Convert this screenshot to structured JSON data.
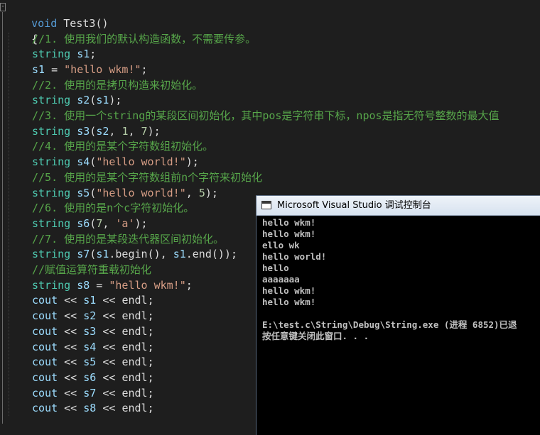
{
  "editor": {
    "fold_glyph": "-",
    "header": [
      "void",
      " ",
      "Test3",
      "()"
    ],
    "brace_open": "{",
    "brace_close": "}",
    "lines": [
      {
        "ind": 1,
        "tokens": [
          [
            "cmt",
            "//1. 使用我们的默认构造函数，不需要传参。"
          ]
        ]
      },
      {
        "ind": 1,
        "tokens": [
          [
            "ty",
            "string"
          ],
          [
            "op",
            " "
          ],
          [
            "var",
            "s1"
          ],
          [
            "op",
            ";"
          ]
        ]
      },
      {
        "ind": 1,
        "tokens": [
          [
            "var",
            "s1"
          ],
          [
            "op",
            " = "
          ],
          [
            "str",
            "\"hello wkm!\""
          ],
          [
            "op",
            ";"
          ]
        ]
      },
      {
        "ind": 1,
        "tokens": [
          [
            "cmt",
            "//2. 使用的是拷贝构造来初始化。"
          ]
        ]
      },
      {
        "ind": 1,
        "tokens": [
          [
            "ty",
            "string"
          ],
          [
            "op",
            " "
          ],
          [
            "var",
            "s2"
          ],
          [
            "op",
            "("
          ],
          [
            "var",
            "s1"
          ],
          [
            "op",
            ");"
          ]
        ]
      },
      {
        "ind": 1,
        "tokens": [
          [
            "cmt",
            "//3. 使用一个string的某段区间初始化，其中pos是字符串下标，npos是指无符号整数的最大值"
          ]
        ]
      },
      {
        "ind": 1,
        "tokens": [
          [
            "ty",
            "string"
          ],
          [
            "op",
            " "
          ],
          [
            "var",
            "s3"
          ],
          [
            "op",
            "("
          ],
          [
            "var",
            "s2"
          ],
          [
            "op",
            ", "
          ],
          [
            "num",
            "1"
          ],
          [
            "op",
            ", "
          ],
          [
            "num",
            "7"
          ],
          [
            "op",
            ");"
          ]
        ]
      },
      {
        "ind": 1,
        "tokens": [
          [
            "cmt",
            "//4. 使用的是某个字符数组初始化。"
          ]
        ]
      },
      {
        "ind": 1,
        "tokens": [
          [
            "ty",
            "string"
          ],
          [
            "op",
            " "
          ],
          [
            "var",
            "s4"
          ],
          [
            "op",
            "("
          ],
          [
            "str",
            "\"hello world!\""
          ],
          [
            "op",
            ");"
          ]
        ]
      },
      {
        "ind": 1,
        "tokens": [
          [
            "cmt",
            "//5. 使用的是某个字符数组前n个字符来初始化"
          ]
        ]
      },
      {
        "ind": 1,
        "tokens": [
          [
            "ty",
            "string"
          ],
          [
            "op",
            " "
          ],
          [
            "var",
            "s5"
          ],
          [
            "op",
            "("
          ],
          [
            "str",
            "\"hello world!\""
          ],
          [
            "op",
            ", "
          ],
          [
            "num",
            "5"
          ],
          [
            "op",
            ");"
          ]
        ]
      },
      {
        "ind": 1,
        "tokens": [
          [
            "cmt",
            "//6. 使用的是n个c字符初始化。"
          ]
        ]
      },
      {
        "ind": 1,
        "tokens": [
          [
            "ty",
            "string"
          ],
          [
            "op",
            " "
          ],
          [
            "var",
            "s6"
          ],
          [
            "op",
            "("
          ],
          [
            "num",
            "7"
          ],
          [
            "op",
            ", "
          ],
          [
            "str",
            "'a'"
          ],
          [
            "op",
            ");"
          ]
        ]
      },
      {
        "ind": 1,
        "tokens": [
          [
            "cmt",
            "//7. 使用的是某段迭代器区间初始化。"
          ]
        ]
      },
      {
        "ind": 1,
        "tokens": [
          [
            "ty",
            "string"
          ],
          [
            "op",
            " "
          ],
          [
            "var",
            "s7"
          ],
          [
            "op",
            "("
          ],
          [
            "var",
            "s1"
          ],
          [
            "op",
            "."
          ],
          [
            "fn",
            "begin"
          ],
          [
            "op",
            "(), "
          ],
          [
            "var",
            "s1"
          ],
          [
            "op",
            "."
          ],
          [
            "fn",
            "end"
          ],
          [
            "op",
            "());"
          ]
        ]
      },
      {
        "ind": 1,
        "tokens": [
          [
            "cmt",
            "//赋值运算符重载初始化"
          ]
        ]
      },
      {
        "ind": 1,
        "tokens": [
          [
            "ty",
            "string"
          ],
          [
            "op",
            " "
          ],
          [
            "var",
            "s8"
          ],
          [
            "op",
            " = "
          ],
          [
            "str",
            "\"hello wkm!\""
          ],
          [
            "op",
            ";"
          ]
        ]
      },
      {
        "ind": 1,
        "tokens": [
          [
            "var",
            "cout"
          ],
          [
            "op",
            " << "
          ],
          [
            "var",
            "s1"
          ],
          [
            "op",
            " << "
          ],
          [
            "fn",
            "endl"
          ],
          [
            "op",
            ";"
          ]
        ]
      },
      {
        "ind": 1,
        "tokens": [
          [
            "var",
            "cout"
          ],
          [
            "op",
            " << "
          ],
          [
            "var",
            "s2"
          ],
          [
            "op",
            " << "
          ],
          [
            "fn",
            "endl"
          ],
          [
            "op",
            ";"
          ]
        ]
      },
      {
        "ind": 1,
        "tokens": [
          [
            "var",
            "cout"
          ],
          [
            "op",
            " << "
          ],
          [
            "var",
            "s3"
          ],
          [
            "op",
            " << "
          ],
          [
            "fn",
            "endl"
          ],
          [
            "op",
            ";"
          ]
        ]
      },
      {
        "ind": 1,
        "tokens": [
          [
            "var",
            "cout"
          ],
          [
            "op",
            " << "
          ],
          [
            "var",
            "s4"
          ],
          [
            "op",
            " << "
          ],
          [
            "fn",
            "endl"
          ],
          [
            "op",
            ";"
          ]
        ]
      },
      {
        "ind": 1,
        "tokens": [
          [
            "var",
            "cout"
          ],
          [
            "op",
            " << "
          ],
          [
            "var",
            "s5"
          ],
          [
            "op",
            " << "
          ],
          [
            "fn",
            "endl"
          ],
          [
            "op",
            ";"
          ]
        ]
      },
      {
        "ind": 1,
        "tokens": [
          [
            "var",
            "cout"
          ],
          [
            "op",
            " << "
          ],
          [
            "var",
            "s6"
          ],
          [
            "op",
            " << "
          ],
          [
            "fn",
            "endl"
          ],
          [
            "op",
            ";"
          ]
        ]
      },
      {
        "ind": 1,
        "tokens": [
          [
            "var",
            "cout"
          ],
          [
            "op",
            " << "
          ],
          [
            "var",
            "s7"
          ],
          [
            "op",
            " << "
          ],
          [
            "fn",
            "endl"
          ],
          [
            "op",
            ";"
          ]
        ]
      },
      {
        "ind": 1,
        "tokens": [
          [
            "var",
            "cout"
          ],
          [
            "op",
            " << "
          ],
          [
            "var",
            "s8"
          ],
          [
            "op",
            " << "
          ],
          [
            "fn",
            "endl"
          ],
          [
            "op",
            ";"
          ]
        ]
      }
    ]
  },
  "console": {
    "title": "Microsoft Visual Studio 调试控制台",
    "output": [
      "hello wkm!",
      "hello wkm!",
      "ello wk",
      "hello world!",
      "hello",
      "aaaaaaa",
      "hello wkm!",
      "hello wkm!",
      "",
      "E:\\test.c\\String\\Debug\\String.exe (进程 6852)已退",
      "按任意键关闭此窗口. . ."
    ]
  },
  "colors": {
    "editor_bg": "#1e1e1e",
    "keyword": "#569cd6",
    "type": "#4ec9b0",
    "comment": "#57a64a",
    "string": "#d69d85",
    "number": "#b5cea8",
    "console_bg": "#000000",
    "console_text": "#c0c0c0"
  }
}
